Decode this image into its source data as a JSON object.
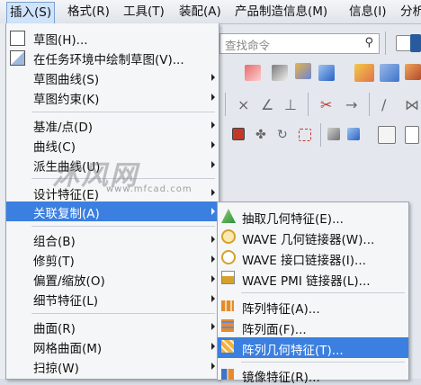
{
  "menubar": {
    "items": [
      "插入(S)",
      "格式(R)",
      "工具(T)",
      "装配(A)",
      "产品制造信息(M)",
      "信息(I)",
      "分析"
    ]
  },
  "search": {
    "placeholder": "查找命令"
  },
  "insert_menu": {
    "items": [
      {
        "label": "草图(H)...",
        "submenu": false
      },
      {
        "label": "在任务环境中绘制草图(V)...",
        "submenu": false
      },
      {
        "label": "草图曲线(S)",
        "submenu": true
      },
      {
        "label": "草图约束(K)",
        "submenu": true
      },
      {
        "label": "基准/点(D)",
        "submenu": true
      },
      {
        "label": "曲线(C)",
        "submenu": true
      },
      {
        "label": "派生曲线(U)",
        "submenu": true
      },
      {
        "label": "设计特征(E)",
        "submenu": true
      },
      {
        "label": "关联复制(A)",
        "submenu": true
      },
      {
        "label": "组合(B)",
        "submenu": true
      },
      {
        "label": "修剪(T)",
        "submenu": true
      },
      {
        "label": "偏置/缩放(O)",
        "submenu": true
      },
      {
        "label": "细节特征(L)",
        "submenu": true
      },
      {
        "label": "曲面(R)",
        "submenu": true
      },
      {
        "label": "网格曲面(M)",
        "submenu": true
      },
      {
        "label": "扫掠(W)",
        "submenu": true
      }
    ]
  },
  "associative_copy_submenu": {
    "items": [
      {
        "label": "抽取几何特征(E)...",
        "icon": "extract-geometry-icon"
      },
      {
        "label": "WAVE 几何链接器(W)...",
        "icon": "wave-geometry-linker-icon"
      },
      {
        "label": "WAVE 接口链接器(I)...",
        "icon": "wave-interface-linker-icon"
      },
      {
        "label": "WAVE PMI 链接器(L)...",
        "icon": "wave-pmi-linker-icon"
      },
      {
        "label": "阵列特征(A)...",
        "icon": "pattern-feature-icon"
      },
      {
        "label": "阵列面(F)...",
        "icon": "pattern-face-icon"
      },
      {
        "label": "阵列几何特征(T)...",
        "icon": "pattern-geometry-icon"
      },
      {
        "label": "镜像特征(R)...",
        "icon": "mirror-feature-icon"
      }
    ]
  },
  "watermark": {
    "brand": "沐风网",
    "url": "www.mfcad.com"
  },
  "colors": {
    "highlight": "#3b7fe0",
    "menu_bg": "#f5f6f7"
  }
}
